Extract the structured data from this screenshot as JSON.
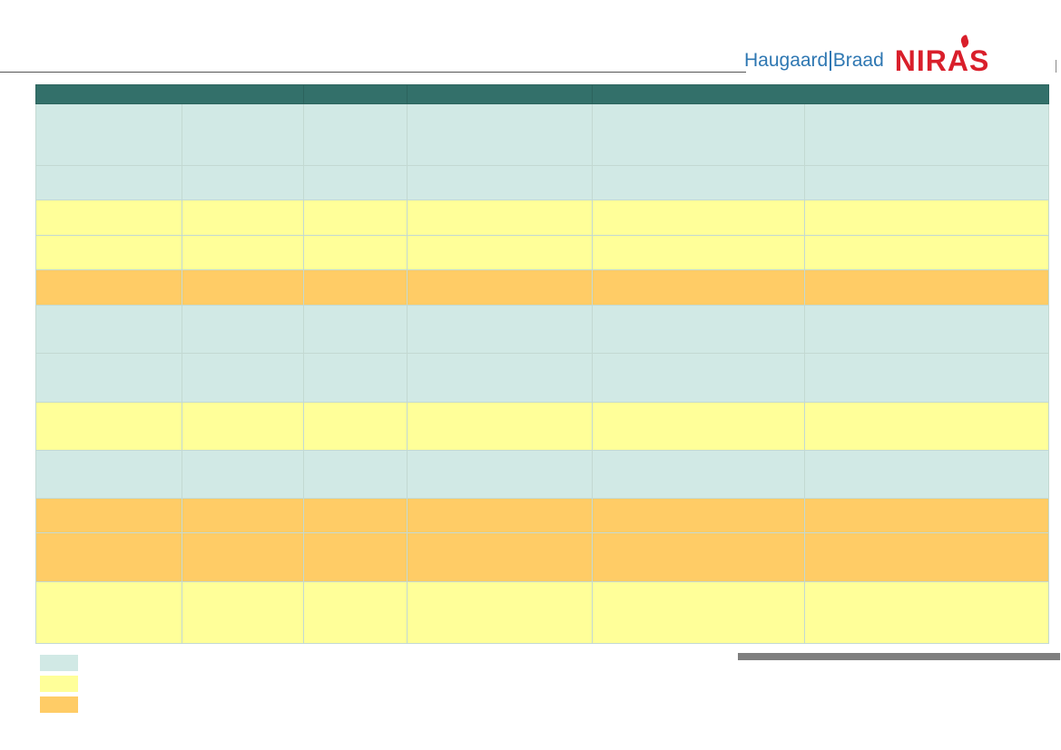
{
  "logo": {
    "brand_left": "Haugaard",
    "brand_right": "Braad",
    "brand_niras": "NIRAS"
  },
  "colors": {
    "header": "#33706a",
    "teal": "#d1e9e5",
    "yellow": "#ffff99",
    "orange": "#ffcc66",
    "niras_red": "#d91f2b",
    "hb_blue": "#2e77b2"
  },
  "table": {
    "headers": [
      "",
      "",
      "",
      "",
      ""
    ],
    "rows": [
      {
        "color": "teal",
        "cells": [
          "",
          "",
          "",
          "",
          "",
          ""
        ]
      },
      {
        "color": "teal",
        "cells": [
          "",
          "",
          "",
          "",
          "",
          ""
        ]
      },
      {
        "color": "yellow",
        "cells": [
          "",
          "",
          "",
          "",
          "",
          ""
        ]
      },
      {
        "color": "yellow",
        "cells": [
          "",
          "",
          "",
          "",
          "",
          ""
        ]
      },
      {
        "color": "orange",
        "cells": [
          "",
          "",
          "",
          "",
          "",
          ""
        ]
      },
      {
        "color": "teal",
        "cells": [
          "",
          "",
          "",
          "",
          "",
          ""
        ]
      },
      {
        "color": "teal",
        "cells": [
          "",
          "",
          "",
          "",
          "",
          ""
        ]
      },
      {
        "color": "yellow",
        "cells": [
          "",
          "",
          "",
          "",
          "",
          ""
        ]
      },
      {
        "color": "teal",
        "cells": [
          "",
          "",
          "",
          "",
          "",
          ""
        ]
      },
      {
        "color": "orange",
        "cells": [
          "",
          "",
          "",
          "",
          "",
          ""
        ]
      },
      {
        "color": "orange",
        "cells": [
          "",
          "",
          "",
          "",
          "",
          ""
        ]
      },
      {
        "color": "yellow",
        "cells": [
          "",
          "",
          "",
          "",
          "",
          ""
        ]
      }
    ]
  },
  "legend": [
    {
      "color": "teal",
      "label": ""
    },
    {
      "color": "yellow",
      "label": ""
    },
    {
      "color": "orange",
      "label": ""
    }
  ]
}
